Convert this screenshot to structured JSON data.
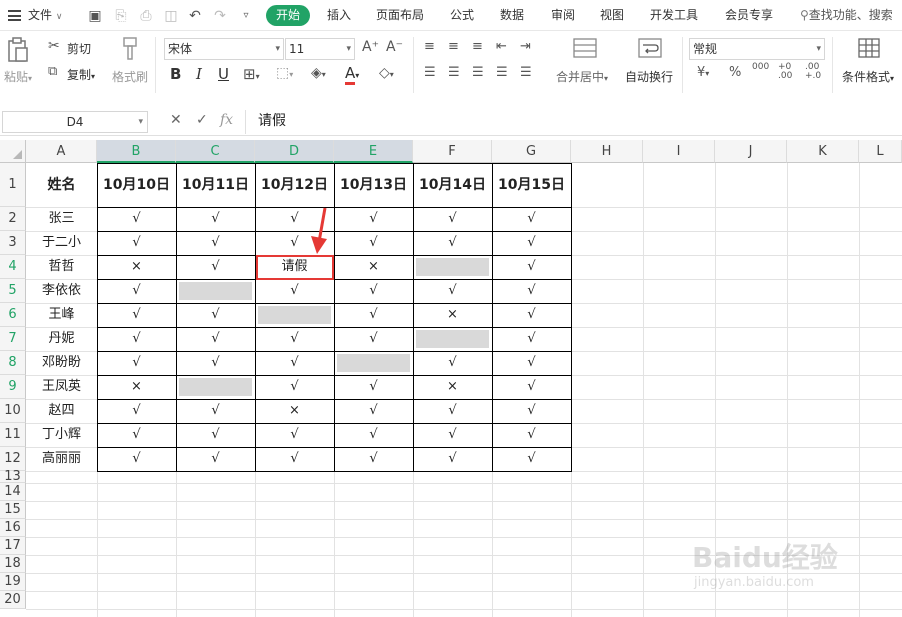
{
  "menu": {
    "file": "文件",
    "tabs": [
      "开始",
      "插入",
      "页面布局",
      "公式",
      "数据",
      "审阅",
      "视图",
      "开发工具",
      "会员专享"
    ],
    "search": "查找功能、搜索"
  },
  "ribbon": {
    "paste": "粘贴",
    "cut": "剪切",
    "copy": "复制",
    "format_painter": "格式刷",
    "font_name": "宋体",
    "font_size": "11",
    "merge": "合并居中",
    "wrap": "自动换行",
    "number_format": "常规",
    "cond_format": "条件格式",
    "increase_font": "A⁺",
    "decrease_font": "A⁻"
  },
  "formula_bar": {
    "name_box": "D4",
    "fx": "fx",
    "content": "请假"
  },
  "columns": [
    "A",
    "B",
    "C",
    "D",
    "E",
    "F",
    "G",
    "H",
    "I",
    "J",
    "K",
    "L"
  ],
  "rows": [
    "1",
    "2",
    "3",
    "4",
    "5",
    "6",
    "7",
    "8",
    "9",
    "10",
    "11",
    "12",
    "13",
    "14",
    "15",
    "16",
    "17",
    "18",
    "19",
    "20"
  ],
  "table": {
    "headers": [
      "姓名",
      "10月10日",
      "10月11日",
      "10月12日",
      "10月13日",
      "10月14日",
      "10月15日"
    ],
    "rows": [
      [
        "张三",
        "√",
        "√",
        "√",
        "√",
        "√",
        "√"
      ],
      [
        "于二小",
        "√",
        "√",
        "√",
        "√",
        "√",
        "√"
      ],
      [
        "哲哲",
        "×",
        "√",
        "请假",
        "×",
        "",
        "√"
      ],
      [
        "李依依",
        "√",
        "",
        "√",
        "√",
        "√",
        "√"
      ],
      [
        "王峰",
        "√",
        "√",
        "",
        "√",
        "×",
        "√"
      ],
      [
        "丹妮",
        "√",
        "√",
        "√",
        "√",
        "",
        "√"
      ],
      [
        "邓盼盼",
        "√",
        "√",
        "√",
        "",
        "√",
        "√"
      ],
      [
        "王凤英",
        "×",
        "",
        "√",
        "√",
        "×",
        "√"
      ],
      [
        "赵四",
        "√",
        "√",
        "×",
        "√",
        "√",
        "√"
      ],
      [
        "丁小辉",
        "√",
        "√",
        "√",
        "√",
        "√",
        "√"
      ],
      [
        "高丽丽",
        "√",
        "√",
        "√",
        "√",
        "√",
        "√"
      ]
    ]
  },
  "colors": {
    "accent": "#21a366",
    "highlight": "#e53935",
    "fill_gray": "#d9d9d9"
  },
  "watermark": {
    "brand": "Baidu经验",
    "url": "jingyan.baidu.com"
  }
}
